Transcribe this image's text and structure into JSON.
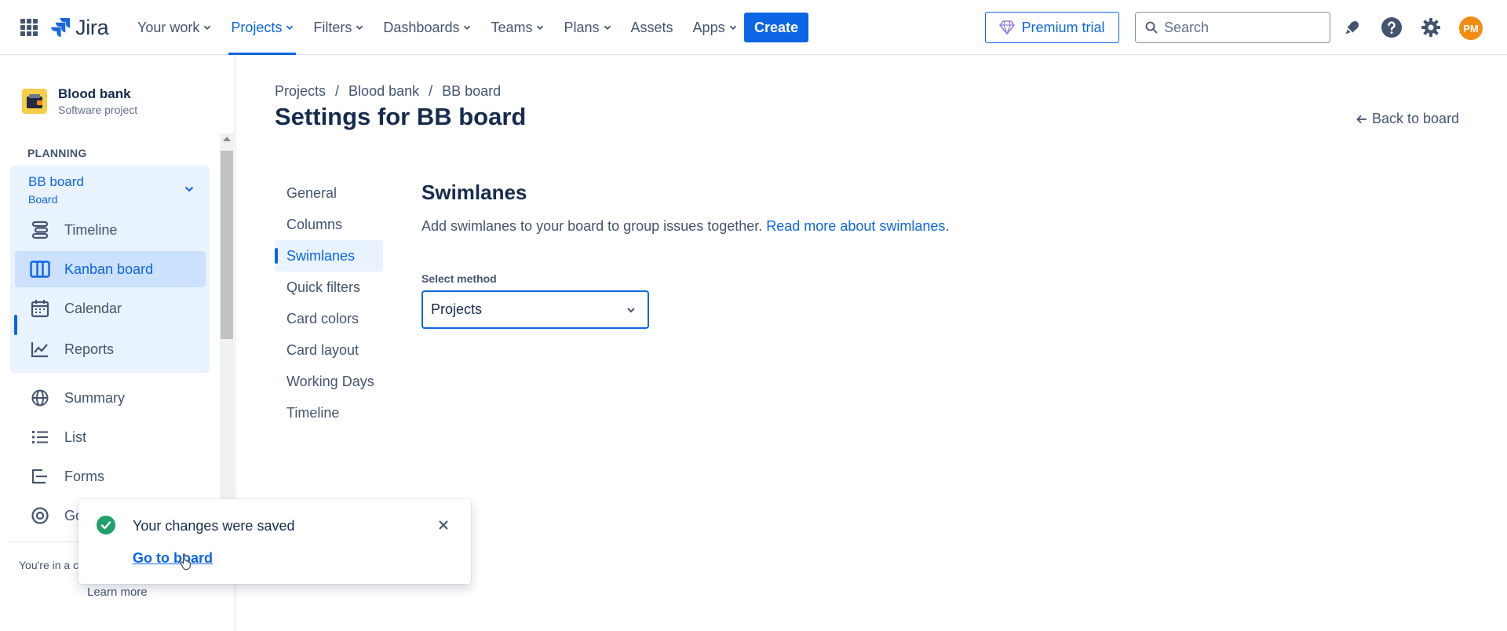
{
  "topnav": {
    "logo_text": "Jira",
    "items": [
      {
        "label": "Your work",
        "has_dropdown": true,
        "active": false
      },
      {
        "label": "Projects",
        "has_dropdown": true,
        "active": true
      },
      {
        "label": "Filters",
        "has_dropdown": true,
        "active": false
      },
      {
        "label": "Dashboards",
        "has_dropdown": true,
        "active": false
      },
      {
        "label": "Teams",
        "has_dropdown": true,
        "active": false
      },
      {
        "label": "Plans",
        "has_dropdown": true,
        "active": false
      },
      {
        "label": "Assets",
        "has_dropdown": false,
        "active": false
      },
      {
        "label": "Apps",
        "has_dropdown": true,
        "active": false
      }
    ],
    "create_label": "Create",
    "premium_label": "Premium trial",
    "search_placeholder": "Search",
    "avatar_initials": "PM",
    "icons": [
      "notifications-icon",
      "help-icon",
      "settings-icon"
    ]
  },
  "sidebar": {
    "project_name": "Blood bank",
    "project_type": "Software project",
    "section_label": "PLANNING",
    "board_title": "BB board",
    "board_subtitle": "Board",
    "items": [
      {
        "label": "Timeline",
        "icon": "timeline-icon",
        "active": false
      },
      {
        "label": "Kanban board",
        "icon": "board-icon",
        "active": true
      },
      {
        "label": "Calendar",
        "icon": "calendar-icon",
        "active": false
      },
      {
        "label": "Reports",
        "icon": "reports-icon",
        "active": false
      },
      {
        "label": "Summary",
        "icon": "globe-icon",
        "active": false
      },
      {
        "label": "List",
        "icon": "list-icon",
        "active": false
      },
      {
        "label": "Forms",
        "icon": "forms-icon",
        "active": false
      },
      {
        "label": "Go",
        "icon": "goals-icon",
        "active": false
      }
    ],
    "footer_text": "You're in a c",
    "learn_more": "Learn more"
  },
  "main": {
    "breadcrumb": [
      "Projects",
      "Blood bank",
      "BB board"
    ],
    "breadcrumb_separator": "/",
    "title": "Settings for BB board",
    "back_link": "Back to board",
    "settings_nav": [
      {
        "label": "General",
        "active": false
      },
      {
        "label": "Columns",
        "active": false
      },
      {
        "label": "Swimlanes",
        "active": true
      },
      {
        "label": "Quick filters",
        "active": false
      },
      {
        "label": "Card colors",
        "active": false
      },
      {
        "label": "Card layout",
        "active": false
      },
      {
        "label": "Working Days",
        "active": false
      },
      {
        "label": "Timeline",
        "active": false
      }
    ],
    "section_title": "Swimlanes",
    "description": "Add swimlanes to your board to group issues together.",
    "description_link": "Read more about swimlanes",
    "description_end": ".",
    "select_label": "Select method",
    "select_value": "Projects"
  },
  "toast": {
    "title": "Your changes were saved",
    "link": "Go to board"
  },
  "colors": {
    "accent": "#0c66e4",
    "active_bg": "#e9f2ff",
    "success": "#22a06b",
    "project_avatar": "#f5cd47",
    "user_avatar": "#f18d13"
  }
}
